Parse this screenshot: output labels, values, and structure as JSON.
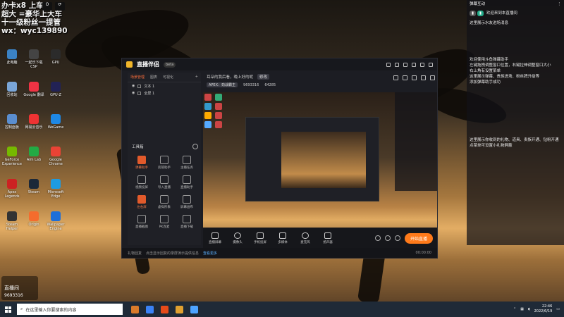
{
  "overlay": {
    "line1": "办卡x8 上车",
    "line2": "超大 =豪华上大车",
    "line3": "十一级粉丝一提管",
    "line4": "wx：wyc139890"
  },
  "top_icons": [
    "O",
    "⟳"
  ],
  "desktop": {
    "icons": [
      {
        "label": "此电脑",
        "color": "#3b82c4"
      },
      {
        "label": "一起乐下载 CSP",
        "color": "#444"
      },
      {
        "label": "GPU",
        "color": "#2b2b2b"
      },
      {
        "label": "回收站",
        "color": "#7aa6d8"
      },
      {
        "label": "Google 翻译",
        "color": "#e34"
      },
      {
        "label": "GPU-Z",
        "color": "#225"
      },
      {
        "label": "控制面板",
        "color": "#5a8ed0"
      },
      {
        "label": "网易云音乐",
        "color": "#e33"
      },
      {
        "label": "WeGame",
        "color": "#1e88e5"
      },
      {
        "label": "GeForce Experience",
        "color": "#76b900"
      },
      {
        "label": "Aim Lab",
        "color": "#2a4"
      },
      {
        "label": "Google Chrome",
        "color": "#ea4335"
      },
      {
        "label": "Apex Legends",
        "color": "#c22"
      },
      {
        "label": "Steam",
        "color": "#1b2838"
      },
      {
        "label": "Microsoft Edge",
        "color": "#1e9be0"
      },
      {
        "label": "Steam Helper",
        "color": "#333"
      },
      {
        "label": "Origin",
        "color": "#f56c2d"
      },
      {
        "label": "Wallpaper Engine",
        "color": "#1e6fd9"
      }
    ]
  },
  "live_badge": {
    "title": "直播间",
    "room": "9693316"
  },
  "right_panel": {
    "header": "弹幕互动",
    "header_right": "⋮",
    "user_line": "欢迎来到本直播间",
    "notice": "这里展示水友进场消息",
    "welcome_block": "欢迎使用斗鱼弹幕助手\n左键拖拽调整窗口位置，右键拉伸调整窗口大小\n右上角有设置菜单\n这里展示弹幕、贵族进场、粉丝牌升级等\n添加弹幕助手成功",
    "gift_block": "这里展示你收到的礼物、道具、贵族开通、钻粉开通\n点菜单可设置小礼物屏蔽"
  },
  "app": {
    "name": "直播伴侣",
    "version": "beta",
    "tabs": [
      "场景管理",
      "图表",
      "可视化"
    ],
    "tab_add": "+",
    "scenes": [
      "文本 1",
      "全屏 1"
    ],
    "tools_title": "工具箱",
    "tools": [
      {
        "label": "弹幕助手",
        "hl": true
      },
      {
        "label": "房管助手",
        "hl": false
      },
      {
        "label": "主播任务",
        "hl": false
      },
      {
        "label": "视频投屏",
        "hl": false
      },
      {
        "label": "导入直播",
        "hl": false
      },
      {
        "label": "直播助手",
        "hl": false
      },
      {
        "label": "左右屏",
        "hl": true
      },
      {
        "label": "虚拟形象",
        "hl": false
      },
      {
        "label": "屏幕画布",
        "hl": false
      },
      {
        "label": "直播截图",
        "hl": false
      },
      {
        "label": "PK连麦",
        "hl": false
      },
      {
        "label": "直播下载",
        "hl": false
      }
    ],
    "stream_title": "耳朵的我后看，晚上好的呢",
    "stream_title_tag": "修改",
    "category": "APEX：劲战霸主",
    "room_no": "9693316",
    "fans": "64285",
    "bottom_buttons": [
      "直播屏幕",
      "摄像头",
      "手机投屏",
      "多媒体",
      "麦克风",
      "扬声器"
    ],
    "go_live": "开始直播",
    "status_left": "礼物回复",
    "status_msg": "点击显示回复的录屏演示提供信息",
    "status_more": "查看更多",
    "status_time": "00:00:00"
  },
  "taskbar": {
    "search_placeholder": "在这里输入你要搜索的内容",
    "time": "22:46",
    "date": "2022/6/19",
    "apps": [
      "#d97b2b",
      "#3b82f6",
      "#e64a19",
      "#e0a030",
      "#4da3ff"
    ]
  }
}
